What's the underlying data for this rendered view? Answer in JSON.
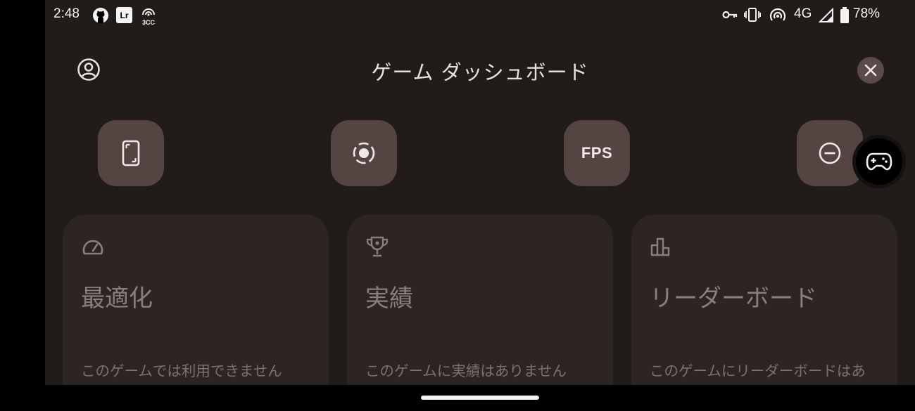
{
  "status_bar": {
    "time": "2:48",
    "left_icons": [
      "github-icon",
      "lightroom-icon",
      "3cc-icon"
    ],
    "lr_text": "Lr",
    "cc_text": "3CC",
    "right_icons": [
      "vpn-key-icon",
      "vibrate-icon",
      "hotspot-icon",
      "signal-icon",
      "battery-icon"
    ],
    "network": "4G",
    "battery": "78%"
  },
  "header": {
    "title": "ゲーム ダッシュボード",
    "profile_icon": "account-circle-icon",
    "close_icon": "close-icon"
  },
  "tiles": [
    {
      "name": "screenshot",
      "icon": "screenshot-icon"
    },
    {
      "name": "record",
      "icon": "record-icon"
    },
    {
      "name": "fps",
      "label": "FPS"
    },
    {
      "name": "do-not-disturb",
      "icon": "do-not-disturb-icon"
    }
  ],
  "floating_button": {
    "icon": "gamepad-icon"
  },
  "cards": [
    {
      "icon": "speedometer-icon",
      "title": "最適化",
      "description": "このゲームでは利用できません"
    },
    {
      "icon": "trophy-icon",
      "title": "実績",
      "description": "このゲームに実績はありません"
    },
    {
      "icon": "leaderboard-icon",
      "title": "リーダーボード",
      "description": "このゲームにリーダーボードはあ"
    }
  ],
  "colors": {
    "background": "#211b1a",
    "tile": "#544542",
    "card": "#2d2524",
    "close_button": "#5a4a48"
  }
}
